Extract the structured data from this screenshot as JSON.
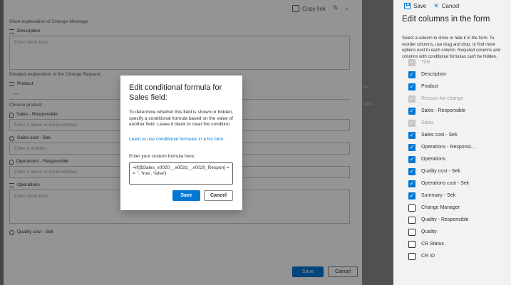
{
  "form": {
    "copy_link": "Copy link",
    "hint_change_message": "Short explanation of Change Message",
    "description_label": "Description",
    "description_placeholder": "Enter value here",
    "hint_change_request": "Detailed explanation of the Change Request",
    "product_label": "Product",
    "product_value": "---",
    "hint_product": "Choose product",
    "sales_responsible_label": "Sales - Responsible",
    "sales_responsible_placeholder": "Enter a name or email address",
    "sales_cost_label": "Sales cost - Sek",
    "sales_cost_placeholder": "Enter a number",
    "operations_responsible_label": "Operations - Responsible",
    "operations_responsible_placeholder": "Enter a name or email address",
    "operations_label": "Operations",
    "operations_placeholder": "Enter value here",
    "quality_cost_label": "Quality cost - Sek",
    "save_label": "Save",
    "cancel_label": "Cancel"
  },
  "modal": {
    "title": "Edit conditional formula for Sales field:",
    "body": "To determine whether this field is shown or hidden, specify a conditional formula based on the value of another field. Leave it blank to clear the condition.",
    "link": "Learn to use conditional formulas in a list form.",
    "input_label": "Enter your custom formula here:",
    "formula_value": "=if([$Sales_x0020__x002d__x0020_Respon] == '', 'true', 'false')",
    "save_label": "Save",
    "cancel_label": "Cancel"
  },
  "panel": {
    "save_label": "Save",
    "cancel_label": "Cancel",
    "title": "Edit columns in the form",
    "description": "Select a column to show or hide it in the form. To reorder columns, use drag and drop, or find more options next to each column. Required columns and columns with conditional formulas can't be hidden.",
    "columns": [
      {
        "label": "Title",
        "state": "locked"
      },
      {
        "label": "Description",
        "state": "checked"
      },
      {
        "label": "Product",
        "state": "checked"
      },
      {
        "label": "Reason for change",
        "state": "locked"
      },
      {
        "label": "Sales - Responsible",
        "state": "checked"
      },
      {
        "label": "Sales",
        "state": "locked"
      },
      {
        "label": "Sales cost - Sek",
        "state": "checked"
      },
      {
        "label": "Operations - Responsi...",
        "state": "checked"
      },
      {
        "label": "Operations",
        "state": "checked"
      },
      {
        "label": "Quality cost - Sek",
        "state": "checked"
      },
      {
        "label": "Operations cost - Sek",
        "state": "checked"
      },
      {
        "label": "Summary - Sek",
        "state": "checked"
      },
      {
        "label": "Change Manager",
        "state": "unchecked"
      },
      {
        "label": "Quality - Responsible",
        "state": "unchecked"
      },
      {
        "label": "Quality",
        "state": "unchecked"
      },
      {
        "label": "CR Status",
        "state": "unchecked"
      },
      {
        "label": "CR ID",
        "state": "unchecked"
      }
    ]
  },
  "colors": {
    "accent": "#0078d4",
    "overlay": "#000000",
    "panel_bg": "#f3f2f1"
  },
  "icons": [
    "copy-link-icon",
    "save-icon",
    "close-icon",
    "checkmark-icon",
    "text-field-icon",
    "choice-field-icon",
    "person-field-icon",
    "number-field-icon"
  ]
}
